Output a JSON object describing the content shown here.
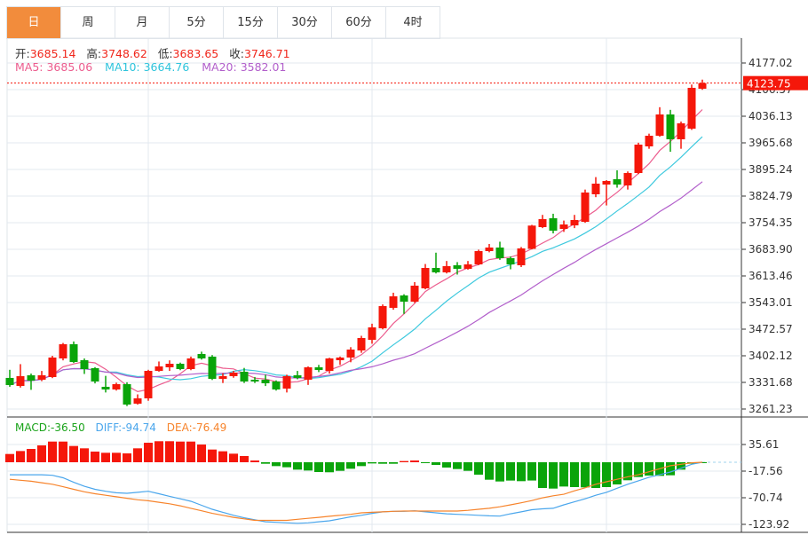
{
  "tabs": [
    {
      "label": "日",
      "active": true
    },
    {
      "label": "周"
    },
    {
      "label": "月"
    },
    {
      "label": "5分"
    },
    {
      "label": "15分"
    },
    {
      "label": "30分"
    },
    {
      "label": "60分"
    },
    {
      "label": "4时"
    }
  ],
  "ohlc_info": {
    "open_label": "开:",
    "open": "3685.14",
    "high_label": "高:",
    "high": "3748.62",
    "low_label": "低:",
    "low": "3683.65",
    "close_label": "收:",
    "close": "3746.71"
  },
  "ma_info": {
    "ma5": "MA5: 3685.06",
    "ma10": "MA10: 3664.76",
    "ma20": "MA20: 3582.01"
  },
  "macd_info": {
    "macd": "MACD:-36.50",
    "diff": "DIFF:-94.74",
    "dea": "DEA:-76.49"
  },
  "colors": {
    "up": "#f5170a",
    "down": "#0aa40a",
    "ma5": "#ec5c8e",
    "ma10": "#3ec9de",
    "ma20": "#b25fcb",
    "diff": "#4aa6ec",
    "dea": "#f7842c",
    "active_tab": "#f28c3c"
  },
  "chart_data": [
    {
      "type": "candlestick",
      "ylim": [
        3261.23,
        4177.02
      ],
      "y_ticks": [
        "4177.02",
        "4106.57",
        "4036.13",
        "3965.68",
        "3895.24",
        "3824.79",
        "3754.35",
        "3683.90",
        "3613.46",
        "3543.01",
        "3472.57",
        "3402.12",
        "3331.68",
        "3261.23"
      ],
      "last_price": "4123.75",
      "grid": true,
      "candles_ohlc": [
        [
          3343.5,
          3365,
          3320,
          3324.7
        ],
        [
          3322.3,
          3380,
          3318,
          3348.2
        ],
        [
          3350.5,
          3355,
          3312,
          3336.4
        ],
        [
          3338.8,
          3362,
          3335,
          3350.5
        ],
        [
          3345.8,
          3402,
          3343,
          3397.5
        ],
        [
          3395.1,
          3436,
          3390,
          3432.7
        ],
        [
          3432.7,
          3440,
          3383,
          3385.7
        ],
        [
          3390.4,
          3395,
          3354,
          3366.9
        ],
        [
          3369.3,
          3372,
          3329,
          3334.1
        ],
        [
          3320,
          3349,
          3305,
          3313
        ],
        [
          3313,
          3331,
          3310,
          3327
        ],
        [
          3327,
          3332,
          3269,
          3273
        ],
        [
          3275.4,
          3300,
          3273,
          3289.5
        ],
        [
          3289.5,
          3365,
          3283,
          3362.2
        ],
        [
          3362.2,
          3387,
          3360,
          3374
        ],
        [
          3371.6,
          3390,
          3362,
          3381
        ],
        [
          3381,
          3384,
          3364,
          3366.9
        ],
        [
          3366.9,
          3400,
          3364,
          3395.1
        ],
        [
          3406.9,
          3413,
          3392,
          3395.1
        ],
        [
          3399.8,
          3404,
          3338,
          3341.1
        ],
        [
          3341.1,
          3356,
          3330,
          3348.2
        ],
        [
          3348.2,
          3362,
          3344,
          3357.5
        ],
        [
          3359.9,
          3370,
          3330,
          3334.1
        ],
        [
          3338.8,
          3346,
          3330,
          3334.1
        ],
        [
          3338.8,
          3352,
          3322,
          3329.4
        ],
        [
          3334.1,
          3337,
          3310,
          3313
        ],
        [
          3315.3,
          3352,
          3305,
          3348.2
        ],
        [
          3350.5,
          3362,
          3340,
          3343.5
        ],
        [
          3338.8,
          3374,
          3325,
          3371.6
        ],
        [
          3371.6,
          3378,
          3359,
          3364.6
        ],
        [
          3362.2,
          3397,
          3355,
          3395.1
        ],
        [
          3390.4,
          3400,
          3378,
          3397.5
        ],
        [
          3397.5,
          3425,
          3385,
          3418.6
        ],
        [
          3416.2,
          3455,
          3410,
          3449.1
        ],
        [
          3444.4,
          3487,
          3434,
          3477.3
        ],
        [
          3475,
          3538,
          3472,
          3533.6
        ],
        [
          3529,
          3569,
          3524,
          3559.5
        ],
        [
          3561.8,
          3565,
          3513,
          3545.4
        ],
        [
          3545.4,
          3597,
          3542,
          3587.7
        ],
        [
          3580.6,
          3645,
          3578,
          3634.6
        ],
        [
          3634.6,
          3675,
          3620,
          3622.9
        ],
        [
          3622.9,
          3653,
          3620,
          3639.3
        ],
        [
          3641.7,
          3650,
          3617,
          3632.3
        ],
        [
          3632.3,
          3653,
          3630,
          3644
        ],
        [
          3644,
          3683,
          3642,
          3679.2
        ],
        [
          3679.2,
          3698,
          3676,
          3688.6
        ],
        [
          3688.6,
          3704,
          3656,
          3660.4
        ],
        [
          3660.4,
          3665,
          3631,
          3644
        ],
        [
          3641.7,
          3690,
          3637,
          3686.3
        ],
        [
          3685.14,
          3748.62,
          3683.65,
          3746.71
        ],
        [
          3742.6,
          3775,
          3740,
          3763.8
        ],
        [
          3766.1,
          3778,
          3726,
          3733.2
        ],
        [
          3737.9,
          3760,
          3730,
          3749.7
        ],
        [
          3747.3,
          3775,
          3740,
          3761.4
        ],
        [
          3756.7,
          3842,
          3754,
          3834.2
        ],
        [
          3829.5,
          3875,
          3822,
          3857.7
        ],
        [
          3855.3,
          3867,
          3800,
          3864.7
        ],
        [
          3869.4,
          3893,
          3847,
          3855.3
        ],
        [
          3853,
          3890,
          3842,
          3885.8
        ],
        [
          3885.8,
          3966,
          3883,
          3961
        ],
        [
          3956.3,
          3990,
          3950,
          3984.5
        ],
        [
          3984.5,
          4060,
          3982,
          4040.8
        ],
        [
          4040.8,
          4053,
          3942,
          3975.1
        ],
        [
          3975.1,
          4022,
          3950,
          4017.3
        ],
        [
          4003.2,
          4120,
          4000,
          4111.3
        ],
        [
          4108.9,
          4133,
          4106,
          4123.75
        ]
      ],
      "moving_averages": [
        "MA5",
        "MA10",
        "MA20"
      ]
    },
    {
      "type": "macd",
      "ylim": [
        -123.92,
        35.61
      ],
      "y_ticks": [
        "35.61",
        "-17.56",
        "-70.74",
        "-123.92"
      ],
      "histogram": [
        16.5,
        22.4,
        26.6,
        33.7,
        41.3,
        41.3,
        32.5,
        27.8,
        21.3,
        18.9,
        18.9,
        17.7,
        27.8,
        39,
        42,
        42,
        41.3,
        41.3,
        35.4,
        25.4,
        21.9,
        17.1,
        12.4,
        3.5,
        -3,
        -7.7,
        -10,
        -14.8,
        -16.5,
        -19.5,
        -20,
        -17.1,
        -13,
        -7.7,
        -2.4,
        -3,
        -3,
        2.4,
        3.5,
        -1.8,
        -5.3,
        -10.6,
        -13.6,
        -17.1,
        -24.8,
        -34.9,
        -38.4,
        -36.6,
        -37.8,
        -36.5,
        -51.4,
        -52.6,
        -48.5,
        -49.6,
        -50.2,
        -51.4,
        -49.6,
        -44.3,
        -36,
        -29.5,
        -26.6,
        -27.2,
        -26,
        -14.8,
        -3,
        -1
      ],
      "diff": [
        -25,
        -25,
        -25,
        -25,
        -26,
        -31,
        -40,
        -48,
        -54,
        -58,
        -61,
        -62,
        -60,
        -58,
        -63,
        -68,
        -73,
        -78,
        -86,
        -94,
        -100,
        -106,
        -111,
        -115,
        -119,
        -120,
        -121,
        -122,
        -121,
        -119,
        -117,
        -113,
        -109,
        -106,
        -102,
        -99,
        -98,
        -98,
        -97,
        -99,
        -101,
        -103,
        -104,
        -105,
        -106,
        -107,
        -107.5,
        -103,
        -99,
        -94.74,
        -93,
        -92,
        -85,
        -79,
        -73,
        -66,
        -60,
        -52,
        -44,
        -37,
        -30,
        -25,
        -19.5,
        -12,
        -4,
        0
      ],
      "dea": [
        -34,
        -36,
        -38,
        -41,
        -44,
        -49,
        -54,
        -59,
        -63,
        -66,
        -69,
        -72,
        -75,
        -77,
        -80,
        -83,
        -87,
        -92,
        -97,
        -102,
        -106,
        -110,
        -113,
        -116,
        -116,
        -116,
        -116,
        -114,
        -112,
        -110,
        -108,
        -106,
        -104,
        -101,
        -100,
        -99,
        -98,
        -97.5,
        -97.5,
        -97.5,
        -97.5,
        -97.5,
        -97.5,
        -96,
        -94,
        -92,
        -89,
        -85,
        -81,
        -76.49,
        -71,
        -67,
        -64,
        -57,
        -51,
        -44,
        -39,
        -34,
        -29,
        -25,
        -19,
        -13,
        -7,
        -4,
        -1,
        0
      ]
    }
  ]
}
